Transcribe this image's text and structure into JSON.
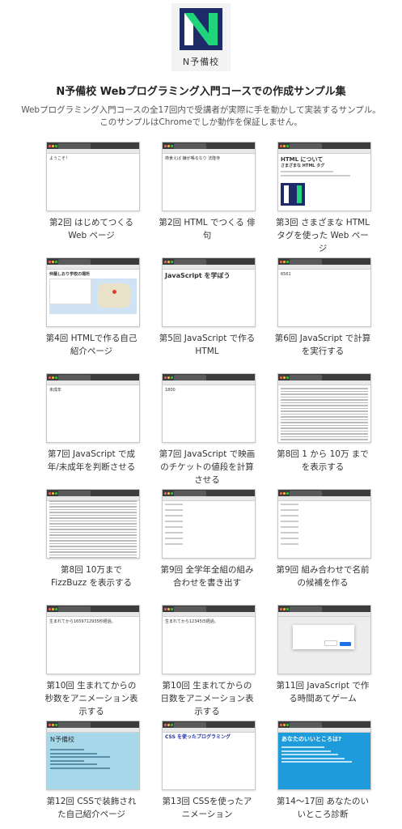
{
  "logo": {
    "caption": "N予備校",
    "colors": {
      "navy": "#1f2a68",
      "green": "#1fd47a"
    }
  },
  "header": {
    "title": "N予備校 Webプログラミング入門コースでの作成サンプル集",
    "desc_line1": "Webプログラミング入門コースの全17回内で受講者が実際に手を動かして実装するサンプル。",
    "desc_line2": "このサンプルはChromeでしか動作を保証しません。"
  },
  "samples": [
    {
      "caption": "第2回 はじめてつくる Web ページ",
      "thumb_text": "ようこそ！"
    },
    {
      "caption": "第2回 HTML でつくる 俳句",
      "thumb_text": "柿食えば 鐘が鳴るなり 法隆寺"
    },
    {
      "caption": "第3回 さまざまな HTML タグを使った Web ページ",
      "thumb_text": "HTML について",
      "thumb_sub": "さまざまな HTML タグ"
    },
    {
      "caption": "第4回 HTMLで作る自己紹介ページ",
      "thumb_text": "仲薗しおり学校の場所"
    },
    {
      "caption": "第5回 JavaScript で作る HTML",
      "thumb_text": "JavaScript を学ぼう"
    },
    {
      "caption": "第6回 JavaScript で計算を実行する",
      "thumb_text": "6561"
    },
    {
      "caption": "第7回 JavaScript で成年/未成年を判断させる",
      "thumb_text": "未成年"
    },
    {
      "caption": "第7回 JavaScript で映画のチケットの値段を計算させる",
      "thumb_text": "1800"
    },
    {
      "caption": "第8回 1 から 10万 までを表示する",
      "thumb_text": ""
    },
    {
      "caption": "第8回 10万まで FizzBuzz を表示する",
      "thumb_text": ""
    },
    {
      "caption": "第9回 全学年全組の組み合わせを書き出す",
      "thumb_text": ""
    },
    {
      "caption": "第9回 組み合わせで名前の候補を作る",
      "thumb_text": ""
    },
    {
      "caption": "第10回 生まれてからの秒数をアニメーション表示する",
      "thumb_text": "生まれてから1659712935秒経過。"
    },
    {
      "caption": "第10回 生まれてからの日数をアニメーション表示する",
      "thumb_text": "生まれてから12345日経過。"
    },
    {
      "caption": "第11回 JavaScript で作る時間あてゲーム",
      "thumb_text": ""
    },
    {
      "caption": "第12回 CSSで装飾された自己紹介ページ",
      "thumb_text": "N予備校"
    },
    {
      "caption": "第13回 CSSを使ったアニメーション",
      "thumb_text": "CSS を使ったプログラミング"
    },
    {
      "caption": "第14〜17回 あなたのいいところ診断",
      "thumb_text": "あなたのいいところは?"
    }
  ]
}
